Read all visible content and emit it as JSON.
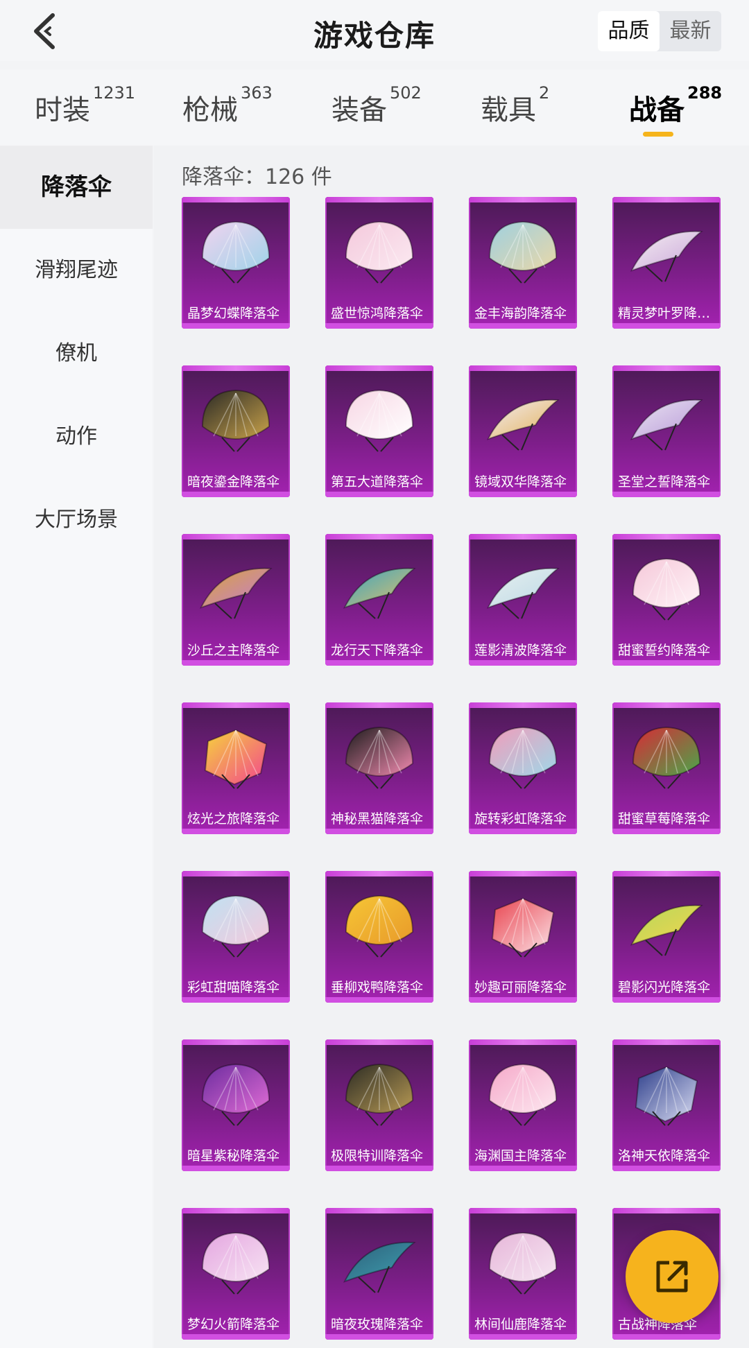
{
  "header": {
    "title": "游戏仓库",
    "sort_options": [
      "品质",
      "最新"
    ],
    "sort_active": 0
  },
  "tabs": [
    {
      "label": "时装",
      "count": "1231"
    },
    {
      "label": "枪械",
      "count": "363"
    },
    {
      "label": "装备",
      "count": "502"
    },
    {
      "label": "载具",
      "count": "2"
    },
    {
      "label": "战备",
      "count": "288"
    }
  ],
  "active_tab": 4,
  "sidebar": {
    "items": [
      "降落伞",
      "滑翔尾迹",
      "僚机",
      "动作",
      "大厅场景"
    ],
    "active": 0
  },
  "content": {
    "count_label": "降落伞：126 件",
    "items": [
      {
        "name": "晶梦幻蝶降落伞",
        "colors": [
          "#f1d3ef",
          "#9fd3e9"
        ],
        "icon": "butterfly-parachute-icon"
      },
      {
        "name": "盛世惊鸿降落伞",
        "colors": [
          "#f4c9dc",
          "#fbe9f1"
        ],
        "icon": "jellyfish-parachute-icon"
      },
      {
        "name": "金丰海韵降落伞",
        "colors": [
          "#9fd0e0",
          "#e8d7a8"
        ],
        "icon": "shell-parachute-icon"
      },
      {
        "name": "精灵梦叶罗降落伞",
        "colors": [
          "#f5eef2",
          "#c9a6d9"
        ],
        "icon": "wing-parachute-icon"
      },
      {
        "name": "暗夜鎏金降落伞",
        "colors": [
          "#2a2a26",
          "#c9a24a"
        ],
        "icon": "black-gold-parachute-icon"
      },
      {
        "name": "第五大道降落伞",
        "colors": [
          "#f7d6e4",
          "#ffffff"
        ],
        "icon": "plaid-parachute-icon"
      },
      {
        "name": "镜域双华降落伞",
        "colors": [
          "#f3ecf2",
          "#e2b25a"
        ],
        "icon": "wing-parachute-icon"
      },
      {
        "name": "圣堂之誓降落伞",
        "colors": [
          "#eae3f2",
          "#b89ad8"
        ],
        "icon": "wing-parachute-icon"
      },
      {
        "name": "沙丘之主降落伞",
        "colors": [
          "#d8a63c",
          "#c47ad2"
        ],
        "icon": "wing-parachute-icon"
      },
      {
        "name": "龙行天下降落伞",
        "colors": [
          "#3aa5c1",
          "#e0c06a"
        ],
        "icon": "wing-parachute-icon"
      },
      {
        "name": "莲影清波降落伞",
        "colors": [
          "#e6f0ef",
          "#bdd8e6"
        ],
        "icon": "wing-parachute-icon"
      },
      {
        "name": "甜蜜誓约降落伞",
        "colors": [
          "#f5c8d9",
          "#fff3f7"
        ],
        "icon": "lace-parachute-icon"
      },
      {
        "name": "炫光之旅降落伞",
        "colors": [
          "#f6d33c",
          "#f2468e"
        ],
        "icon": "square-parachute-icon"
      },
      {
        "name": "神秘黑猫降落伞",
        "colors": [
          "#1c1c1c",
          "#f28ab0"
        ],
        "icon": "black-cat-parachute-icon"
      },
      {
        "name": "旋转彩虹降落伞",
        "colors": [
          "#f29cba",
          "#9fd7e8"
        ],
        "icon": "umbrella-parachute-icon"
      },
      {
        "name": "甜蜜草莓降落伞",
        "colors": [
          "#d92a36",
          "#4aa64a"
        ],
        "icon": "strawberry-parachute-icon"
      },
      {
        "name": "彩虹甜喵降落伞",
        "colors": [
          "#bfe1f2",
          "#f4c9dc"
        ],
        "icon": "round-parachute-icon"
      },
      {
        "name": "垂柳戏鸭降落伞",
        "colors": [
          "#f6c636",
          "#e89a2a"
        ],
        "icon": "duck-parachute-icon"
      },
      {
        "name": "妙趣可丽降落伞",
        "colors": [
          "#e9444f",
          "#fbe1e6"
        ],
        "icon": "square-parachute-icon"
      },
      {
        "name": "碧影闪光降落伞",
        "colors": [
          "#b6d95b",
          "#f2d34e"
        ],
        "icon": "wing-parachute-icon"
      },
      {
        "name": "暗星紫秘降落伞",
        "colors": [
          "#6b2c9e",
          "#e06cd5"
        ],
        "icon": "round-parachute-icon"
      },
      {
        "name": "极限特训降落伞",
        "colors": [
          "#2b2b24",
          "#b89a54"
        ],
        "icon": "black-gold-parachute-icon"
      },
      {
        "name": "海渊国主降落伞",
        "colors": [
          "#f5a9c9",
          "#fde7f0"
        ],
        "icon": "round-parachute-icon"
      },
      {
        "name": "洛神天依降落伞",
        "colors": [
          "#2c3d8a",
          "#d9dcf2"
        ],
        "icon": "square-parachute-icon"
      },
      {
        "name": "梦幻火箭降落伞",
        "colors": [
          "#e4a6e0",
          "#f7e3f3"
        ],
        "icon": "round-parachute-icon"
      },
      {
        "name": "暗夜玫瑰降落伞",
        "colors": [
          "#2d5f7a",
          "#3fa0b0"
        ],
        "icon": "wing-parachute-icon"
      },
      {
        "name": "林间仙鹿降落伞",
        "colors": [
          "#e6b6d9",
          "#f6e6f2"
        ],
        "icon": "round-parachute-icon"
      },
      {
        "name": "古战神降落伞",
        "colors": [
          "#7a5a2a",
          "#c6a46a"
        ],
        "icon": "wing-parachute-icon"
      }
    ]
  },
  "fab": {
    "icon": "share-icon"
  }
}
